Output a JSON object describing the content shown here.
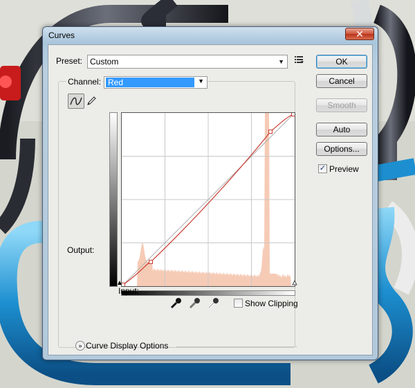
{
  "window": {
    "title": "Curves",
    "close_glyph": "✕"
  },
  "preset": {
    "label": "Preset:",
    "value": "Custom",
    "menu_icon": "menu-lines-icon"
  },
  "channel": {
    "label": "Channel:",
    "value": "Red"
  },
  "tools": {
    "curve_tool": "curve-icon",
    "pencil_tool": "pencil-icon"
  },
  "curves": {
    "output_label": "Output:",
    "input_label": "Input:"
  },
  "eyedroppers": [
    "black-point-eyedropper-icon",
    "gray-point-eyedropper-icon",
    "white-point-eyedropper-icon"
  ],
  "show_clipping": {
    "label": "Show Clipping",
    "checked": false
  },
  "display_options": {
    "label": "Curve Display Options"
  },
  "buttons": {
    "ok": "OK",
    "cancel": "Cancel",
    "smooth": "Smooth",
    "auto": "Auto",
    "options": "Options..."
  },
  "preview": {
    "label": "Preview",
    "checked": true,
    "check_glyph": "✓"
  },
  "colors": {
    "selection": "#3399ff",
    "curve": "#c83c32",
    "histogram": "#f6cbb6",
    "close": "#c8452c"
  }
}
